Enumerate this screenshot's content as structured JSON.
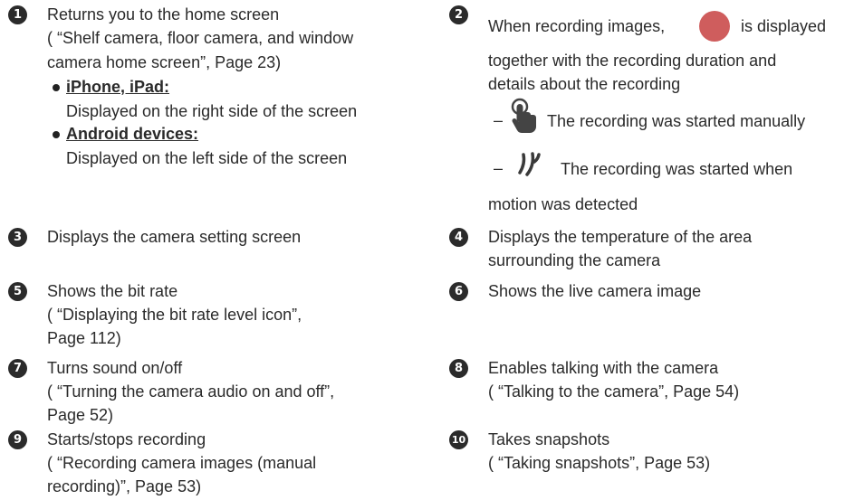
{
  "items": {
    "i1": {
      "num": "1",
      "lines": [
        "Returns you to the home screen",
        "( “Shelf camera, floor camera, and window",
        "camera home screen”, Page 23)"
      ],
      "bullets": [
        {
          "title": "iPhone, iPad:",
          "desc": "Displayed on the right side of the screen"
        },
        {
          "title": "Android devices:",
          "desc": "Displayed on the left side of the screen"
        }
      ]
    },
    "i2": {
      "num": "2",
      "line1a": "When recording images,",
      "line1b": "is displayed",
      "line2": "together with the recording duration and",
      "line3": "details about the recording",
      "dash": "–",
      "manual": "The recording was started manually",
      "motion1": "The recording was started when",
      "motion2": "motion was detected"
    },
    "i3": {
      "num": "3",
      "lines": [
        "Displays the camera setting screen"
      ]
    },
    "i4": {
      "num": "4",
      "lines": [
        "Displays the temperature of the area",
        "surrounding the camera"
      ]
    },
    "i5": {
      "num": "5",
      "lines": [
        "Shows the bit rate",
        "( “Displaying the bit rate level icon”,",
        "Page 112)"
      ]
    },
    "i6": {
      "num": "6",
      "lines": [
        "Shows the live camera image"
      ]
    },
    "i7": {
      "num": "7",
      "lines": [
        "Turns sound on/off",
        "( “Turning the camera audio on and off”,",
        "Page 52)"
      ]
    },
    "i8": {
      "num": "8",
      "lines": [
        "Enables talking with the camera",
        "( “Talking to the camera”, Page 54)"
      ]
    },
    "i9": {
      "num": "9",
      "lines": [
        "Starts/stops recording",
        "( “Recording camera images (manual",
        "recording)”, Page 53)"
      ]
    },
    "i10": {
      "num": "10",
      "lines": [
        "Takes snapshots",
        "( “Taking snapshots”, Page 53)"
      ]
    }
  },
  "icons": {
    "record": "recording-indicator-icon",
    "manual": "hand-tap-icon",
    "motion": "motion-waves-icon"
  },
  "colors": {
    "record_dot": "#cf5d5d",
    "text": "#2a2a2a",
    "icon": "#3a3a3a"
  }
}
